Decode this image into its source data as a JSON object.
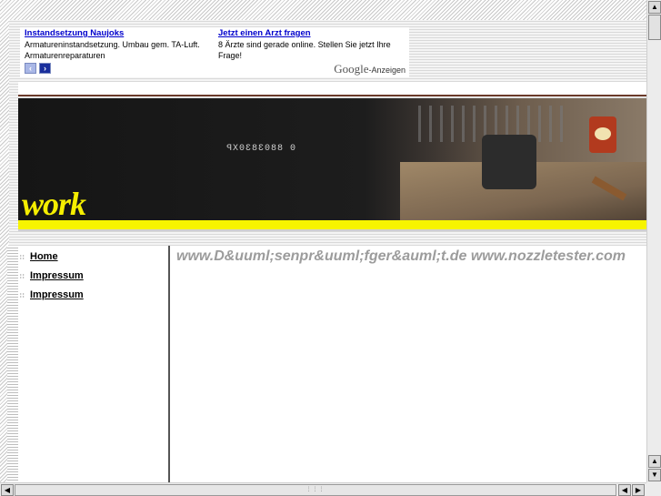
{
  "ads": {
    "items": [
      {
        "title": "Instandsetzung Naujoks",
        "text": "Armatureninstandsetzung. Umbau gem. TA-Luft. Armaturenreparaturen"
      },
      {
        "title": "Jetzt einen Arzt fragen",
        "text": "8 Ärzte sind gerade online. Stellen Sie jetzt Ihre Frage!"
      }
    ],
    "prev_icon": "chevron-left-icon",
    "next_icon": "chevron-right-icon",
    "brand": "Google",
    "brand_suffix": "-Anzeigen"
  },
  "banner": {
    "word": "work",
    "display_text": "0 8803830XP"
  },
  "nav": {
    "items": [
      {
        "label": "Home"
      },
      {
        "label": "Impressum"
      },
      {
        "label": "Impressum"
      }
    ]
  },
  "main": {
    "headline": "www.D&uuml;senpr&uuml;fger&auml;t.de www.nozzletester.com"
  },
  "colors": {
    "banner_accent": "#f7f400",
    "link": "#0000cc",
    "headline": "#9c9c9c"
  }
}
